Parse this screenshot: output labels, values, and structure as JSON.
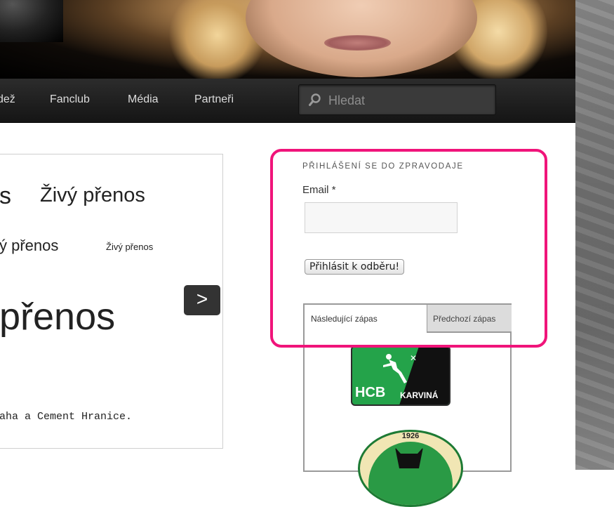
{
  "nav": {
    "items": [
      "dež",
      "Fanclub",
      "Média",
      "Partneři"
    ],
    "search_placeholder": "Hledat"
  },
  "slider": {
    "text_large_left": "s",
    "text_1": "Živý přenos",
    "text_2": "ý přenos",
    "text_3": "Živý přenos",
    "text_big": "přenos",
    "description": "aha a Cement Hranice.",
    "next_label": ">"
  },
  "newsletter": {
    "title": "PŘIHLÁŠENÍ SE DO ZPRAVODAJE",
    "email_label": "Email",
    "required_mark": "*",
    "subscribe_label": "Přihlásit k odběru!"
  },
  "matches": {
    "tabs": [
      "Následující zápas",
      "Předchozí zápas"
    ],
    "team1": {
      "line1": "HCB",
      "line2": "KARVINÁ"
    },
    "team2": {
      "year": "1926"
    }
  },
  "colors": {
    "highlight": "#f0147a",
    "nav_bg": "#1e1e1e",
    "hcb_green": "#24a34a"
  }
}
